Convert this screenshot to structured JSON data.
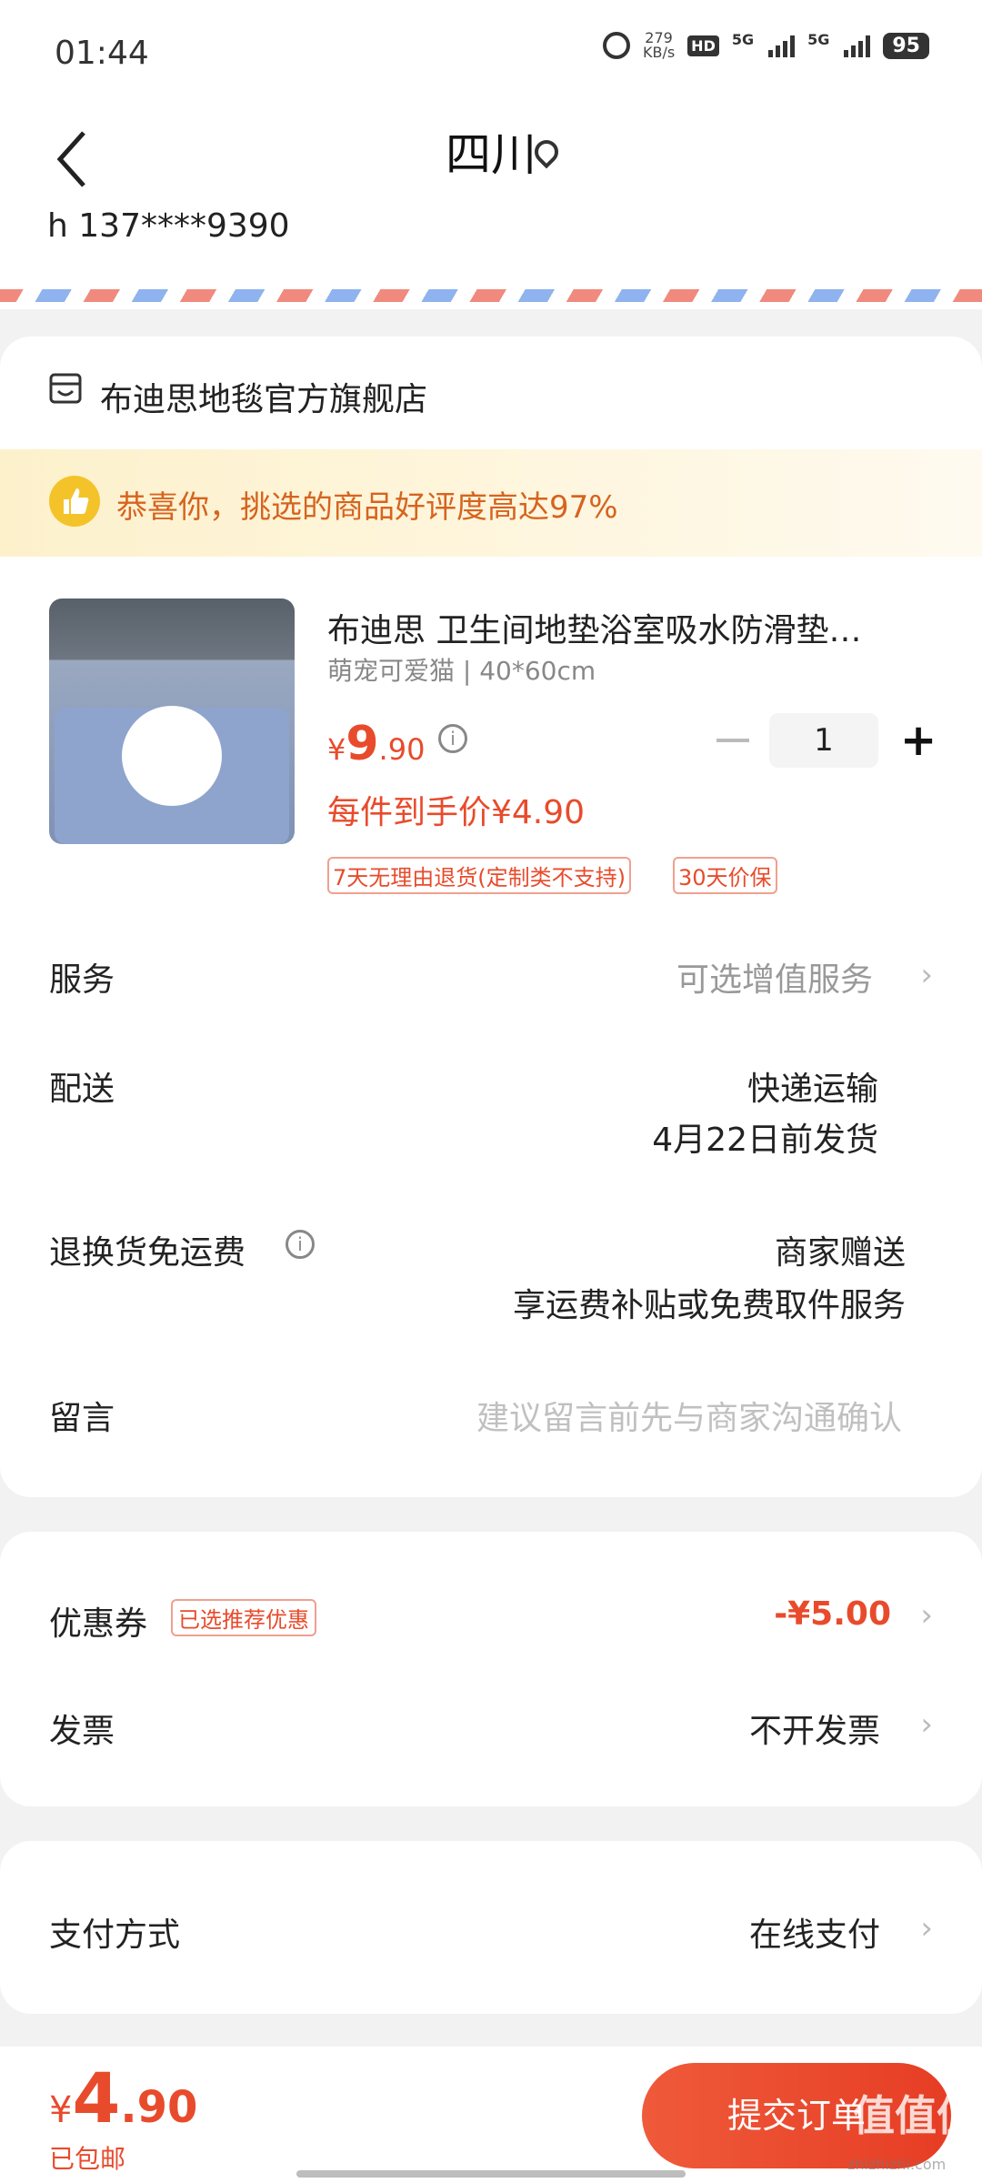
{
  "status_bar": {
    "time": "01:44",
    "net_speed": "279",
    "net_unit": "KB/s",
    "hd_label": "HD",
    "sim1": "5G",
    "sim2": "5G",
    "battery": "95"
  },
  "header": {
    "title": "四川",
    "back_icon": "chevron-left-icon",
    "location_icon": "location-pin-icon"
  },
  "address": {
    "phone": "h  137****9390"
  },
  "store": {
    "name": "布迪思地毯官方旗舰店",
    "icon": "store-icon"
  },
  "promo": {
    "text": "恭喜你，挑选的商品好评度高达97%",
    "icon": "thumbs-up-icon"
  },
  "product": {
    "title": "布迪思 卫生间地垫浴室吸水防滑垫…",
    "spec": "萌宠可爱猫 | 40*60cm",
    "price_symbol": "¥",
    "price_int": "9",
    "price_dec": ".90",
    "quantity": "1",
    "deal_price": "每件到手价¥4.90",
    "tags": [
      "7天无理由退货(定制类不支持)",
      "30天价保"
    ]
  },
  "rows": {
    "service": {
      "label": "服务",
      "value": "可选增值服务"
    },
    "delivery": {
      "label": "配送",
      "value1": "快递运输",
      "value2": "4月22日前发货"
    },
    "return": {
      "label": "退换货免运费",
      "value1": "商家赠送",
      "value2": "享运费补贴或免费取件服务"
    },
    "message": {
      "label": "留言",
      "placeholder": "建议留言前先与商家沟通确认"
    },
    "coupon": {
      "label": "优惠券",
      "badge": "已选推荐优惠",
      "value": "-¥5.00"
    },
    "invoice": {
      "label": "发票",
      "value": "不开发票"
    },
    "payment": {
      "label": "支付方式",
      "value": "在线支付"
    }
  },
  "bottom": {
    "symbol": "¥",
    "total_int": "4",
    "total_dec": ".90",
    "shipping": "已包邮",
    "submit": "提交订单"
  },
  "watermark": {
    "main": "值值值",
    "sub": "zhizhizhi.com"
  },
  "colors": {
    "accent": "#e84b2c",
    "promo_text": "#d6641f",
    "promo_bg": "#fdf1cc"
  }
}
